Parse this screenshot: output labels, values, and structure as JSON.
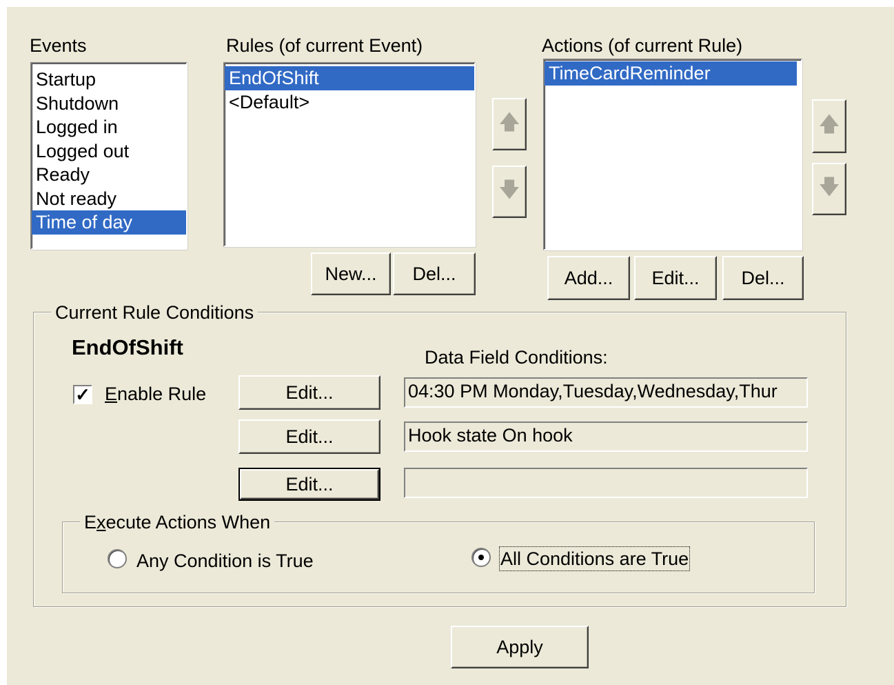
{
  "events": {
    "label": "Events",
    "items": [
      "Startup",
      "Shutdown",
      "Logged in",
      "Logged out",
      "Ready",
      "Not ready",
      "Time of day"
    ],
    "selected": "Time of day"
  },
  "rules": {
    "label": "Rules (of current Event)",
    "items": [
      "EndOfShift",
      "<Default>"
    ],
    "selected": "EndOfShift",
    "new_label": "New...",
    "del_label": "Del..."
  },
  "actions": {
    "label": "Actions (of current Rule)",
    "items": [
      "TimeCardReminder"
    ],
    "selected": "TimeCardReminder",
    "add_label": "Add...",
    "edit_label": "Edit...",
    "del_label": "Del..."
  },
  "arrows": {
    "up": "🡅",
    "down": "🡇",
    "up_icon": "arrow-up-icon",
    "down_icon": "arrow-down-icon"
  },
  "conditions": {
    "group_title": "Current Rule Conditions",
    "rule_name": "EndOfShift",
    "enable_rule_prefix": "E",
    "enable_rule_rest": "nable Rule",
    "enable_rule_checked": true,
    "checkmark": "✓",
    "data_field_label": "Data Field Conditions:",
    "rows": [
      {
        "edit_label": "Edit...",
        "value": "04:30 PM Monday,Tuesday,Wednesday,Thur"
      },
      {
        "edit_label": "Edit...",
        "value": "Hook state On hook"
      },
      {
        "edit_label": "Edit...",
        "value": ""
      }
    ]
  },
  "execute": {
    "group_title_prefix": "E",
    "group_title_mid": "x",
    "group_title_rest": "ecute Actions When",
    "any_label": "Any Condition is True",
    "all_label": "All Conditions are True",
    "selected": "all"
  },
  "apply_label": "Apply",
  "colors": {
    "dialog_bg": "#ece9d8",
    "selection": "#316ac5"
  }
}
